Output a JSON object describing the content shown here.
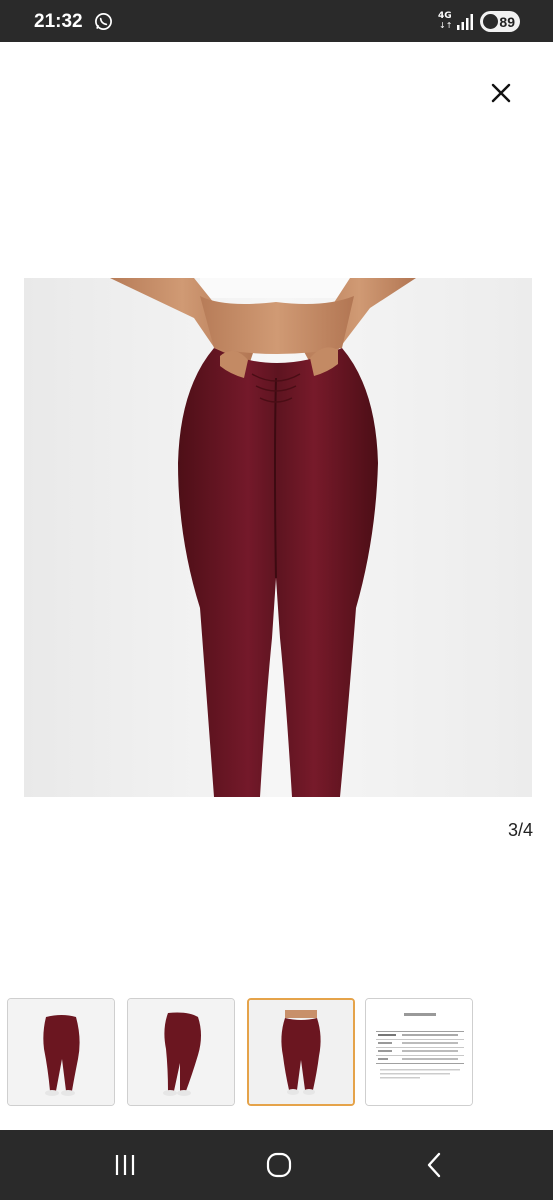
{
  "status_bar": {
    "time": "21:32",
    "network": "4G",
    "network_arrows": "↓↑",
    "battery": "89",
    "icons": [
      "whatsapp-icon",
      "signal-icon",
      "battery-icon"
    ]
  },
  "viewer": {
    "close_icon": "close-icon",
    "counter": "3/4",
    "current_index": 3,
    "total": 4,
    "product_color": "#6b1620"
  },
  "thumbnails": [
    {
      "label": "legging-front-view"
    },
    {
      "label": "legging-side-view"
    },
    {
      "label": "legging-back-view",
      "selected": true
    },
    {
      "label": "size-table",
      "title": "Size Table",
      "headers": [
        "Plus size CM",
        "S",
        "M",
        "L",
        "XL",
        "XXL"
      ]
    }
  ],
  "colors": {
    "status_bar_bg": "#2a2a2a",
    "selected_border": "#e5a34a",
    "legging": "#6b1620"
  },
  "nav_bar": {
    "icons": [
      "recent-apps-icon",
      "home-icon",
      "back-icon"
    ]
  }
}
